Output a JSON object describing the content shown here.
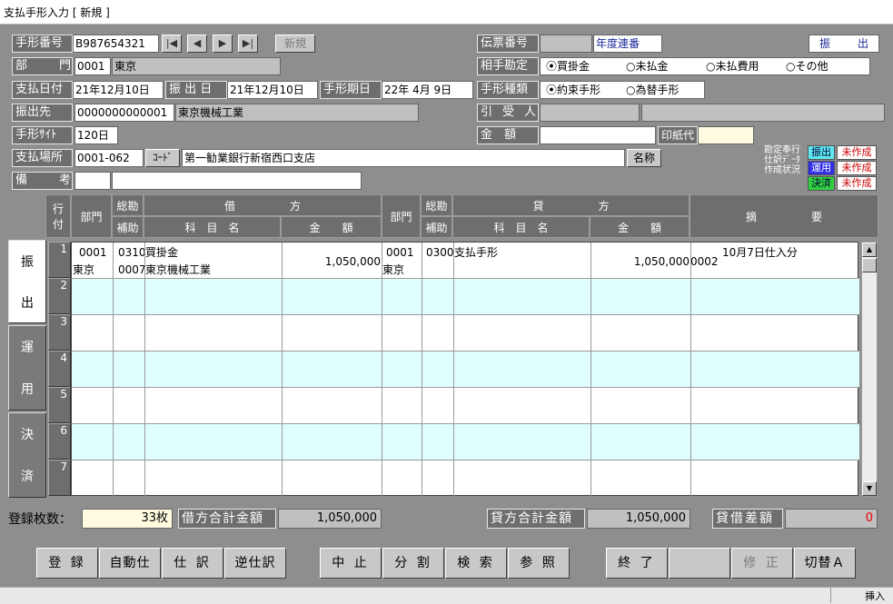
{
  "window": {
    "title": "支払手形入力 [ 新規 ]"
  },
  "header": {
    "tegata_no_label": "手形番号",
    "tegata_no_value": "B987654321",
    "new_button": "新規",
    "bumon_label": "部　門",
    "bumon_code": "0001",
    "bumon_name": "東京",
    "shiharai_date_label": "支払日付",
    "shiharai_date_value": "21年12月10日",
    "furidashi_date_label": "振 出 日",
    "furidashi_date_value": "21年12月10日",
    "kijitsu_label": "手形期日",
    "kijitsu_value": "22年 4月 9日",
    "furidashisaki_label": "振出先",
    "furidashisaki_code": "0000000000001",
    "furidashisaki_name": "東京機械工業",
    "site_label": "手形ｻｲﾄ",
    "site_value": "120日",
    "basho_label": "支払場所",
    "basho_code": "0001-062",
    "code_button": "ｺｰﾄﾞ",
    "basho_name": "第一勧業銀行新宿西口支店",
    "meisho_button": "名称",
    "biko_label": "備　考",
    "denpyo_label": "伝票番号",
    "nendo_label": "年度連番",
    "mode_badge": "振　　出",
    "aite_label": "相手勘定",
    "aite_options": [
      "買掛金",
      "未払金",
      "未払費用",
      "その他"
    ],
    "shurui_label": "手形種類",
    "shurui_options": [
      "約束手形",
      "為替手形"
    ],
    "hikiuke_label": "引受人",
    "kingaku_label": "金　額",
    "inshi_label": "印紙代",
    "status_title_1": "勘定奉行",
    "status_title_2": "仕訳ﾃﾞｰﾀ",
    "status_title_3": "作成状況",
    "status_items": [
      {
        "name": "振出",
        "state": "未作成"
      },
      {
        "name": "運用",
        "state": "未作成"
      },
      {
        "name": "決済",
        "state": "未作成"
      }
    ]
  },
  "grid": {
    "col_gyo": "行",
    "col_tsuke": "付",
    "col_bumon": "部門",
    "col_sokan": "総勘",
    "col_hojo": "補助",
    "col_kari": "借　　　　　方",
    "col_kashi": "貸　　　　　方",
    "col_kamoku": "科　目　名",
    "col_kingaku": "金　　額",
    "col_tekiyo": "摘　　　　　要",
    "row_numbers": [
      "1",
      "2",
      "3",
      "4",
      "5",
      "6",
      "7"
    ],
    "row1": {
      "d_bumon": "0001",
      "d_bumon_name": "東京",
      "d_sokan": "0310",
      "d_kamoku": "買掛金",
      "d_hojo": "0007",
      "d_hojo_name": "東京機械工業",
      "d_amount": "1,050,000",
      "c_bumon": "0001",
      "c_bumon_name": "東京",
      "c_sokan": "0300",
      "c_kamoku": "支払手形",
      "c_amount": "1,050,000",
      "tekiyo_code": "0002",
      "tekiyo": "10月7日仕入分"
    }
  },
  "tabs": [
    {
      "top": "振",
      "bottom": "出"
    },
    {
      "top": "運",
      "bottom": "用"
    },
    {
      "top": "決",
      "bottom": "済"
    }
  ],
  "totals": {
    "count_label": "登録枚数：",
    "count_value": "33枚",
    "debit_label": "借方合計金額",
    "debit_value": "1,050,000",
    "credit_label": "貸方合計金額",
    "credit_value": "1,050,000",
    "diff_label": "貸借差額",
    "diff_value": "0"
  },
  "buttons": {
    "toroku": "登 録",
    "jidoshi": "自動仕",
    "shiwake": "仕 訳",
    "gyakushiwake": "逆仕訳",
    "chushi": "中 止",
    "bunkatsu": "分 割",
    "kensaku": "検 索",
    "sansho": "参 照",
    "shuryo": "終 了",
    "blank": "",
    "shusei": "修 正",
    "kirikae": "切替Ａ"
  },
  "statusbar": {
    "mode": "挿入"
  }
}
